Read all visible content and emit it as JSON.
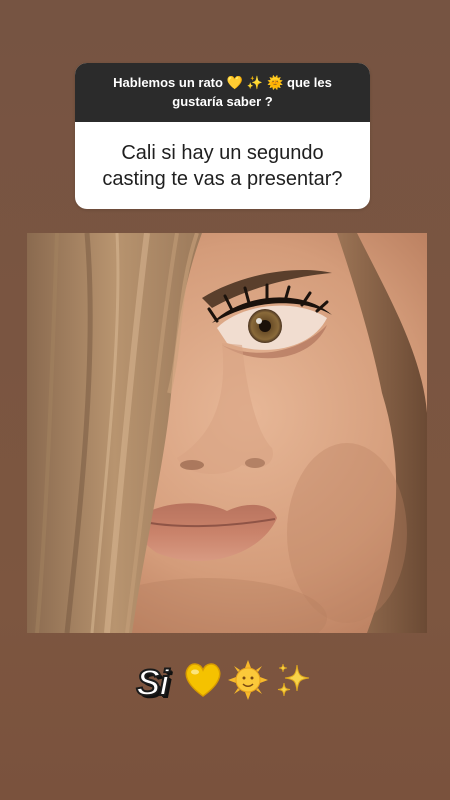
{
  "question_box": {
    "prompt_before": "Hablemos un rato",
    "prompt_emojis": "💛 ✨ 🌞",
    "prompt_after": "que les gustaría saber ?",
    "question": "Cali si hay un segundo casting te vas a presentar?"
  },
  "answer": {
    "text": "Si",
    "emojis": [
      "yellow-heart",
      "sun-with-face",
      "sparkles"
    ]
  },
  "colors": {
    "background": "#7a5541",
    "header_bg": "#2b2b2b",
    "card_bg": "#ffffff",
    "heart": "#f5c200",
    "sun": "#f7b92a",
    "sparkles": "#f7d34a"
  }
}
